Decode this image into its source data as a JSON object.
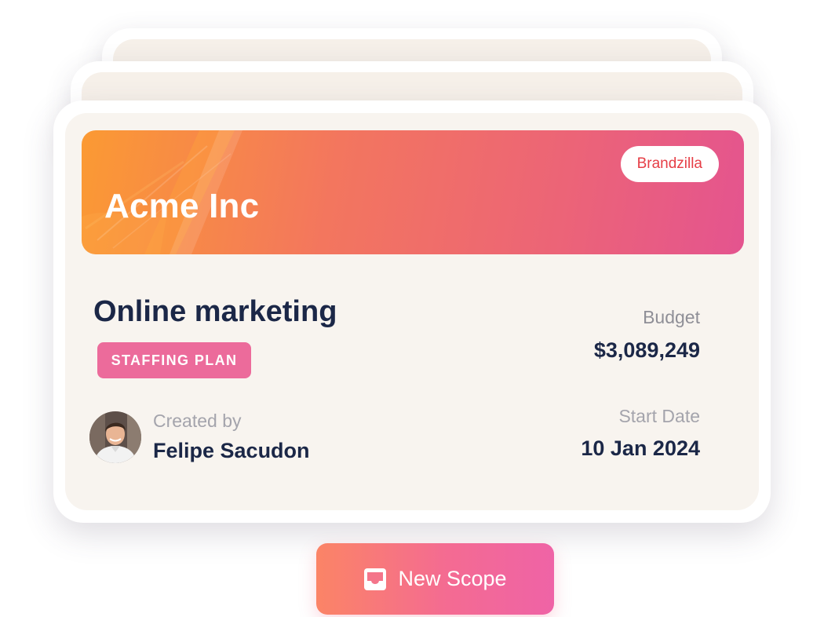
{
  "card": {
    "client_name": "Acme Inc",
    "agency_badge": "Brandzilla",
    "project_title": "Online marketing",
    "plan_tag": "STAFFING PLAN",
    "created_by_label": "Created by",
    "creator_name": "Felipe Sacudon",
    "budget_label": "Budget",
    "budget_value": "$3,089,249",
    "start_date_label": "Start Date",
    "start_date_value": "10 Jan 2024"
  },
  "actions": {
    "new_scope_label": "New Scope",
    "new_scope_icon": "inbox-icon"
  },
  "colors": {
    "banner_gradient_start": "#fb9a33",
    "banner_gradient_end": "#e4548f",
    "badge_text": "#e63e46",
    "tag_background": "#ec6b9b",
    "heading_text": "#1b2747",
    "card_background": "#f8f4ef",
    "button_gradient_start": "#fb8466",
    "button_gradient_end": "#ef63a6"
  }
}
